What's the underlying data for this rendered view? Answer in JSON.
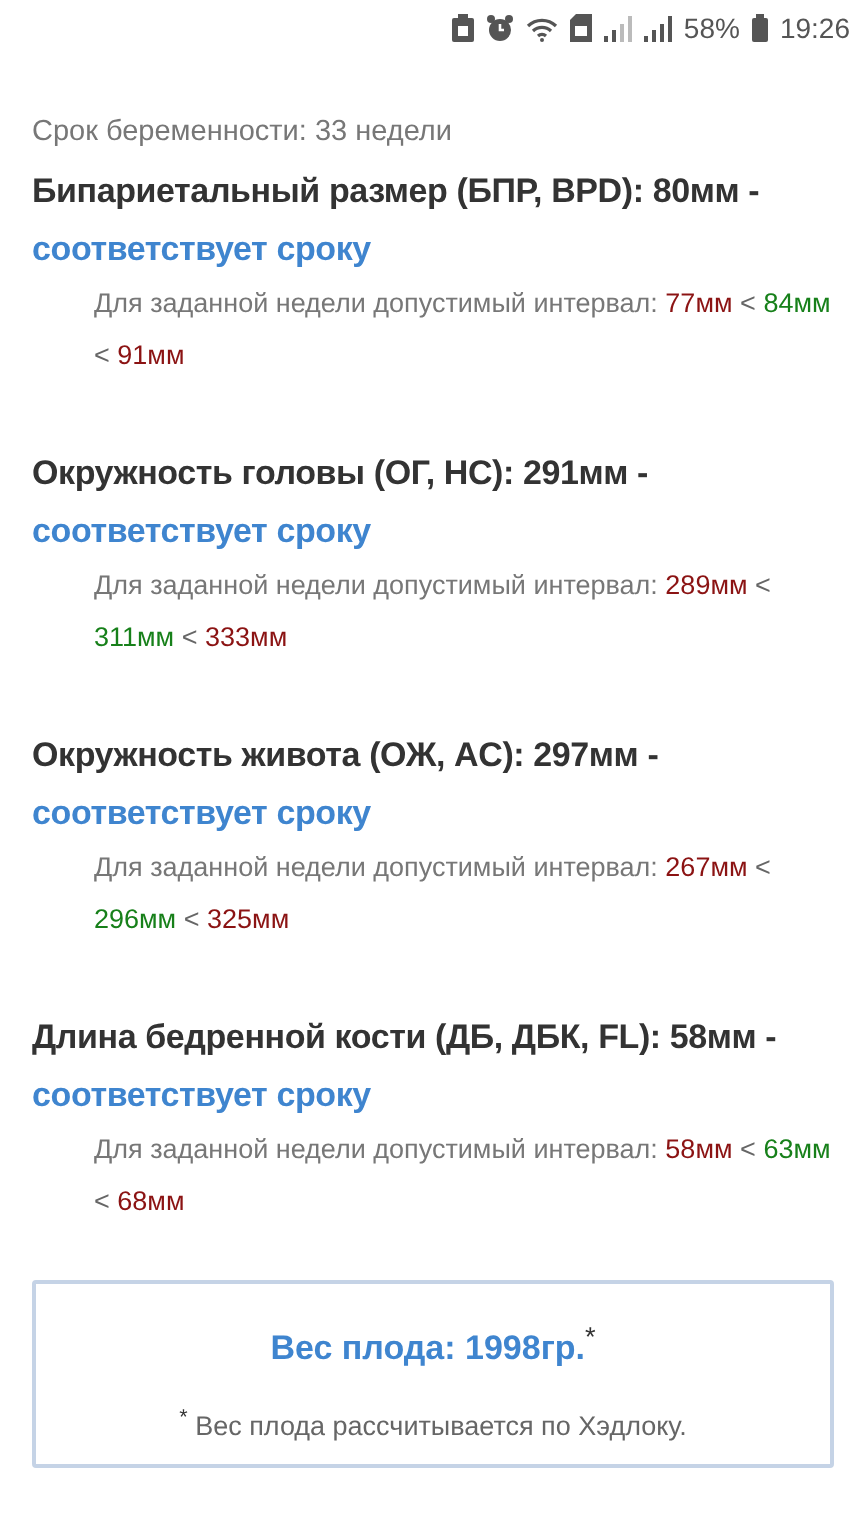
{
  "status_bar": {
    "battery": "58%",
    "time": "19:26"
  },
  "term": "Срок беременности: 33 недели",
  "measurements": [
    {
      "title": "Бипариетальный размер (БПР, BPD): 80мм -",
      "verdict": "соответствует сроку",
      "range_label": "Для заданной недели допустимый интервал:",
      "range": [
        {
          "kind": "limit",
          "text": "77мм"
        },
        {
          "kind": "sep",
          "text": "<"
        },
        {
          "kind": "value",
          "text": "84мм"
        },
        {
          "kind": "sep",
          "text": "<"
        },
        {
          "kind": "limit",
          "text": "91мм"
        }
      ]
    },
    {
      "title": "Окружность головы (ОГ, HC): 291мм -",
      "verdict": "соответствует сроку",
      "range_label": "Для заданной недели допустимый интервал:",
      "range": [
        {
          "kind": "limit",
          "text": "289мм"
        },
        {
          "kind": "sep",
          "text": "<"
        },
        {
          "kind": "value",
          "text": "311мм"
        },
        {
          "kind": "sep",
          "text": "<"
        },
        {
          "kind": "limit",
          "text": "333мм"
        }
      ]
    },
    {
      "title": "Окружность живота (ОЖ, AC): 297мм -",
      "verdict": "соответствует сроку",
      "range_label": "Для заданной недели допустимый интервал:",
      "range": [
        {
          "kind": "limit",
          "text": "267мм"
        },
        {
          "kind": "sep",
          "text": "<"
        },
        {
          "kind": "value",
          "text": "296мм"
        },
        {
          "kind": "sep",
          "text": "<"
        },
        {
          "kind": "limit",
          "text": "325мм"
        }
      ]
    },
    {
      "title": "Длина бедренной кости (ДБ, ДБК, FL): 58мм -",
      "verdict": "соответствует сроку",
      "range_label": "Для заданной недели допустимый интервал:",
      "range": [
        {
          "kind": "limit",
          "text": "58мм"
        },
        {
          "kind": "sep",
          "text": "<"
        },
        {
          "kind": "value",
          "text": "63мм"
        },
        {
          "kind": "sep",
          "text": "<"
        },
        {
          "kind": "limit",
          "text": "68мм"
        }
      ]
    }
  ],
  "weight": {
    "value": "Вес плода: 1998гр.$^{*}$",
    "note": "$^{*}$ Вес плода рассчитывается по Хэдлоку."
  }
}
